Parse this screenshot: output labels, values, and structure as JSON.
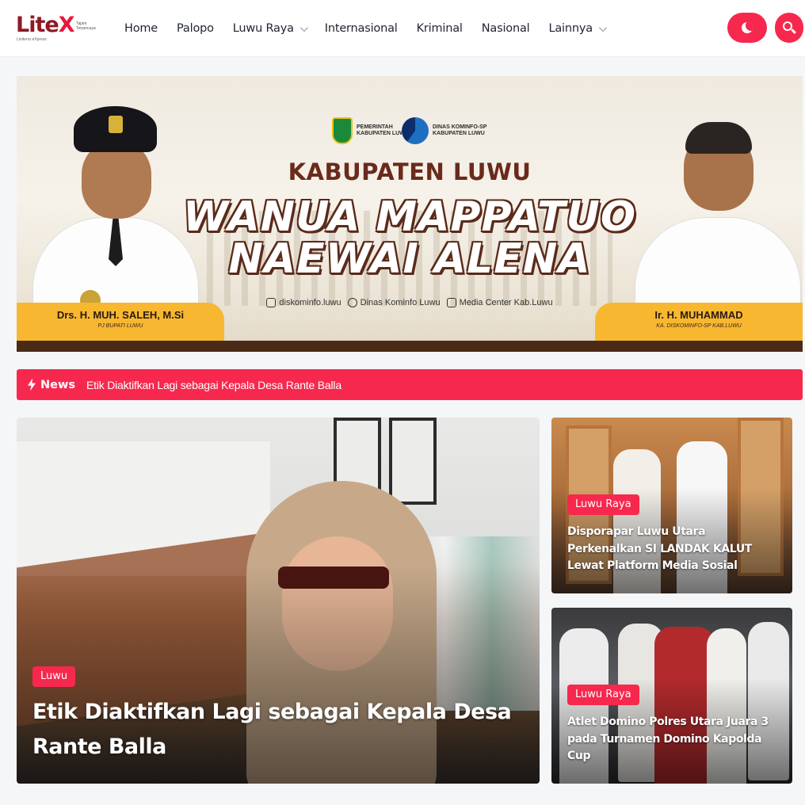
{
  "site": {
    "logo_word": "Lite",
    "logo_x": "X",
    "logo_tagline": "Tajam Terpercaya",
    "logo_sub": "Liniterra eXpress"
  },
  "nav": {
    "items": [
      {
        "label": "Home",
        "has_dropdown": false
      },
      {
        "label": "Palopo",
        "has_dropdown": false
      },
      {
        "label": "Luwu Raya",
        "has_dropdown": true
      },
      {
        "label": "Internasional",
        "has_dropdown": false
      },
      {
        "label": "Kriminal",
        "has_dropdown": false
      },
      {
        "label": "Nasional",
        "has_dropdown": false
      },
      {
        "label": "Lainnya",
        "has_dropdown": true
      }
    ],
    "dark_mode_icon": "moon-icon",
    "search_icon": "search-icon"
  },
  "banner": {
    "gov_label": "PEMERINTAH KABUPATEN LUWU",
    "dinas_label": "DINAS KOMINFO-SP KABUPATEN LUWU",
    "heading": "KABUPATEN LUWU",
    "slogan_line1": "WANUA MAPPATUO",
    "slogan_line2": "NAEWAI ALENA",
    "socials": [
      "diskominfo.luwu",
      "Dinas Kominfo Luwu",
      "Media Center Kab.Luwu"
    ],
    "left_name": "Drs. H. MUH. SALEH, M.Si",
    "left_role": "PJ BUPATI LUWU",
    "right_name": "Ir. H. MUHAMMAD",
    "right_role": "KA. DISKOMINFO-SP KAB.LUWU"
  },
  "ticker": {
    "label": "News",
    "text": "Etik Diaktifkan Lagi sebagai Kepala Desa Rante Balla"
  },
  "featured": {
    "main": {
      "category": "Luwu",
      "title": "Etik Diaktifkan Lagi sebagai Kepala Desa Rante Balla"
    },
    "side": [
      {
        "category": "Luwu Raya",
        "title": "Disporapar Luwu Utara Perkenalkan SI LANDAK KALUT Lewat Platform Media Sosial"
      },
      {
        "category": "Luwu Raya",
        "title": "Atlet Domino Polres Utara Juara 3 pada Turnamen Domino Kapolda Cup"
      }
    ]
  },
  "colors": {
    "accent": "#f7284e",
    "logo_dark": "#8e1a24",
    "banner_gold": "#f7b731",
    "banner_brown": "#4a2a16"
  }
}
